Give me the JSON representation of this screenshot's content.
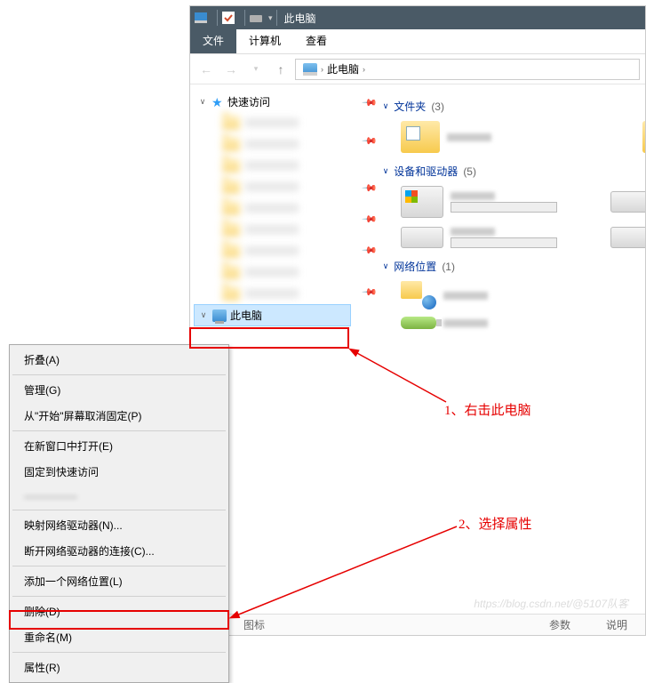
{
  "titlebar": {
    "title": "此电脑"
  },
  "ribbon": {
    "tabs": [
      "文件",
      "计算机",
      "查看"
    ]
  },
  "breadcrumb": {
    "root": "此电脑"
  },
  "sidebar": {
    "quick_access": "快速访问",
    "this_pc": "此电脑"
  },
  "groups": {
    "folders": {
      "label": "文件夹",
      "count": "(3)"
    },
    "devices": {
      "label": "设备和驱动器",
      "count": "(5)"
    },
    "network": {
      "label": "网络位置",
      "count": "(1)"
    }
  },
  "context_menu": {
    "collapse": "折叠(A)",
    "manage": "管理(G)",
    "unpin_start": "从\"开始\"屏幕取消固定(P)",
    "open_new_window": "在新窗口中打开(E)",
    "pin_quick": "固定到快速访问",
    "map_drive": "映射网络驱动器(N)...",
    "disconnect_drive": "断开网络驱动器的连接(C)...",
    "add_net_location": "添加一个网络位置(L)",
    "delete": "删除(D)",
    "rename": "重命名(M)",
    "properties": "属性(R)"
  },
  "annotations": {
    "step1": "1、右击此电脑",
    "step2": "2、选择属性"
  },
  "statusbar": {
    "icons": "图标",
    "params": "参数",
    "desc": "说明"
  },
  "watermark": "https://blog.csdn.net/@5107队客"
}
